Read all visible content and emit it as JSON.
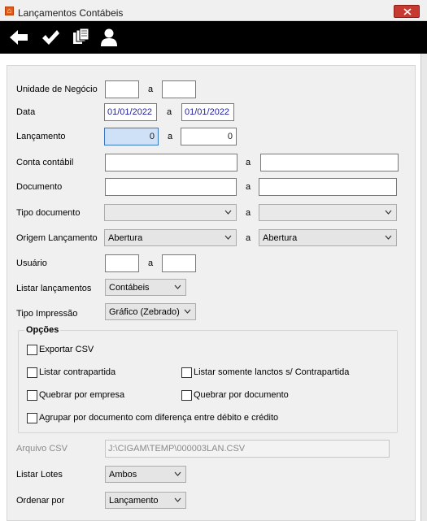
{
  "window": {
    "title": "Lançamentos Contábeis"
  },
  "toolbar": {
    "icons": [
      "back-arrow-icon",
      "check-icon",
      "copy-pages-icon",
      "user-icon"
    ]
  },
  "form": {
    "unidade": {
      "label": "Unidade de Negócio",
      "sep": "a",
      "from": "",
      "to": ""
    },
    "data": {
      "label": "Data",
      "sep": "a",
      "from": "01/01/2022",
      "to": "01/01/2022"
    },
    "lancamento": {
      "label": "Lançamento",
      "sep": "a",
      "from": "0",
      "to": "0"
    },
    "conta": {
      "label": "Conta contábil",
      "sep": "a",
      "from": "",
      "to": ""
    },
    "documento": {
      "label": "Documento",
      "sep": "a",
      "from": "",
      "to": ""
    },
    "tipo_documento": {
      "label": "Tipo documento",
      "sep": "a",
      "from": "",
      "to": ""
    },
    "origem": {
      "label": "Origem Lançamento",
      "sep": "a",
      "from": "Abertura",
      "to": "Abertura"
    },
    "usuario": {
      "label": "Usuário",
      "sep": "a",
      "from": "",
      "to": ""
    },
    "listar_lancamentos": {
      "label": "Listar lançamentos",
      "value": "Contábeis"
    },
    "tipo_impressao": {
      "label": "Tipo Impressão",
      "value": "Gráfico (Zebrado)"
    },
    "opcoes": {
      "title": "Opções",
      "exportar_csv": {
        "label": "Exportar CSV",
        "checked": false
      },
      "listar_contrapartida": {
        "label": "Listar contrapartida",
        "checked": false
      },
      "listar_somente": {
        "label": "Listar somente lanctos s/ Contrapartida",
        "checked": false
      },
      "quebrar_empresa": {
        "label": "Quebrar por empresa",
        "checked": false
      },
      "quebrar_documento": {
        "label": "Quebrar por documento",
        "checked": false
      },
      "agrupar": {
        "label": "Agrupar por documento com diferença entre débito e crédito",
        "checked": false
      }
    },
    "arquivo_csv": {
      "label": "Arquivo CSV",
      "value": "J:\\CIGAM\\TEMP\\000003LAN.CSV"
    },
    "listar_lotes": {
      "label": "Listar Lotes",
      "value": "Ambos"
    },
    "ordenar_por": {
      "label": "Ordenar por",
      "value": "Lançamento"
    }
  },
  "colors": {
    "toolbar_bg": "#000000",
    "close_red": "#c63a32",
    "focus_blue": "#3a76c4",
    "panel_bg": "#f0f0f0"
  }
}
